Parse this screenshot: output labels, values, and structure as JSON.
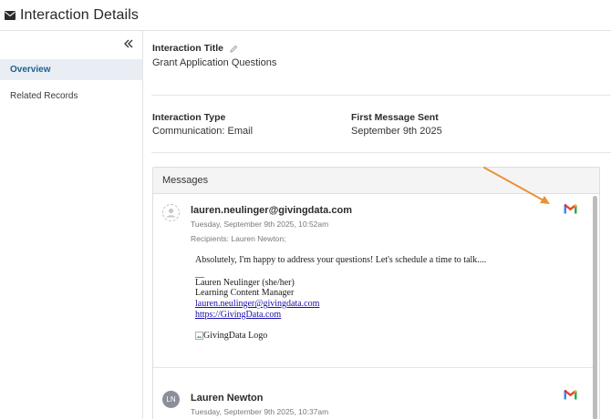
{
  "header": {
    "title": "Interaction Details",
    "icon": "envelope-icon"
  },
  "sidebar": {
    "collapse_icon": "double-chevron-left-icon",
    "items": [
      {
        "label": "Overview",
        "active": true
      },
      {
        "label": "Related Records",
        "active": false
      }
    ]
  },
  "details": {
    "title_label": "Interaction Title",
    "title_value": "Grant Application Questions",
    "edit_icon": "pencil-icon",
    "type_label": "Interaction Type",
    "type_value": "Communication: Email",
    "first_sent_label": "First Message Sent",
    "first_sent_value": "September 9th 2025"
  },
  "messages": {
    "header": "Messages",
    "items": [
      {
        "sender": "lauren.neulinger@givingdata.com",
        "timestamp": "Tuesday, September 9th 2025, 10:52am",
        "recipients": "Recipients: Lauren Newton;",
        "avatar": "generic-user-icon",
        "source_icon": "gmail-icon",
        "body": {
          "text": "Absolutely, I'm happy to address your questions! Let's schedule a time to talk....",
          "sig_separator": "__",
          "sig_name": "Lauren Neulinger (she/her)",
          "sig_title": "Learning Content Manager",
          "sig_email": "lauren.neulinger@givingdata.com",
          "sig_url": "https://GivingData.com",
          "logo_alt": "GivingData Logo"
        }
      },
      {
        "sender": "Lauren Newton",
        "timestamp": "Tuesday, September 9th 2025, 10:37am",
        "avatar_initials": "LN",
        "source_icon": "gmail-icon"
      }
    ]
  },
  "colors": {
    "accent": "#1f5f8f",
    "active_nav_bg": "#e8eef4",
    "annotation_arrow": "#e8923a"
  }
}
